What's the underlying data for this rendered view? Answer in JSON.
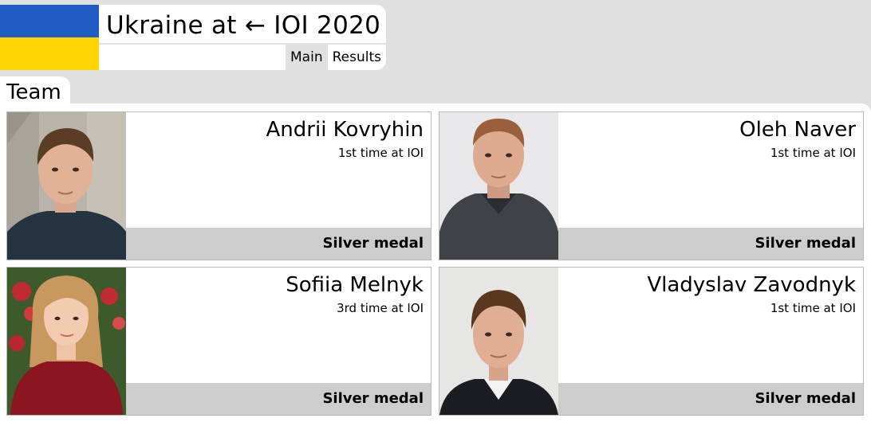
{
  "header": {
    "title": "Ukraine at ← IOI 2020",
    "flag_colors": {
      "top": "#1f5cc4",
      "bottom": "#ffd500"
    },
    "nav": [
      {
        "label": "Main",
        "active": true
      },
      {
        "label": "Results",
        "active": false
      }
    ]
  },
  "section": {
    "title": "Team"
  },
  "team": [
    {
      "name": "Andrii Kovryhin",
      "participation": "1st time at IOI",
      "medal": "Silver medal"
    },
    {
      "name": "Oleh Naver",
      "participation": "1st time at IOI",
      "medal": "Silver medal"
    },
    {
      "name": "Sofiia Melnyk",
      "participation": "3rd time at IOI",
      "medal": "Silver medal"
    },
    {
      "name": "Vladyslav Zavodnyk",
      "participation": "1st time at IOI",
      "medal": "Silver medal"
    }
  ]
}
